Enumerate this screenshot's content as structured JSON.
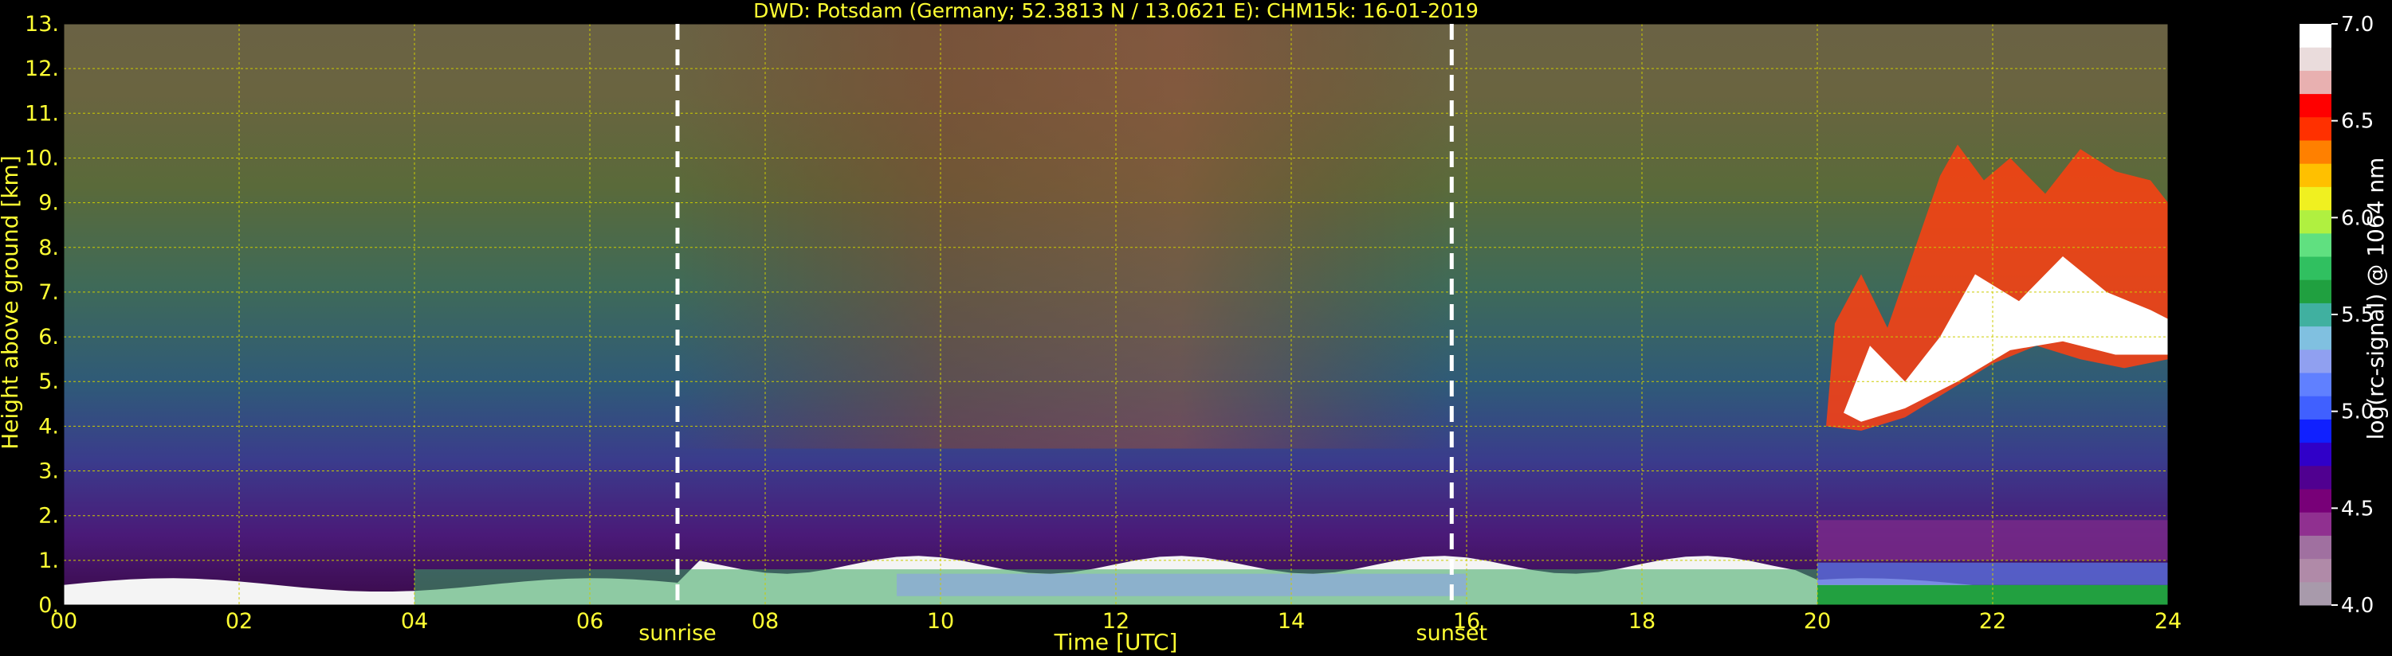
{
  "chart_data": {
    "type": "heatmap",
    "title": "DWD: Potsdam (Germany; 52.3813 N / 13.0621 E):    CHM15k: 16-01-2019",
    "xlabel": "Time [UTC]",
    "ylabel": "Height above ground [km]",
    "xlim": [
      0,
      24
    ],
    "ylim": [
      0,
      13
    ],
    "x_ticks": [
      "00",
      "02",
      "04",
      "06",
      "08",
      "10",
      "12",
      "14",
      "16",
      "18",
      "20",
      "22",
      "24"
    ],
    "y_ticks": [
      "0.",
      "1.",
      "2.",
      "3.",
      "4.",
      "5.",
      "6.",
      "7.",
      "8.",
      "9.",
      "10.",
      "11.",
      "12.",
      "13."
    ],
    "grid": true,
    "events": [
      {
        "label": "sunrise",
        "time": 7.0
      },
      {
        "label": "sunset",
        "time": 15.83
      }
    ],
    "colorbar": {
      "label": "log(rc-signal) @ 1064 nm",
      "range": [
        4.0,
        7.0
      ],
      "ticks": [
        "4.0",
        "4.5",
        "5.0",
        "5.5",
        "6.0",
        "6.5",
        "7.0"
      ],
      "colors": [
        "#a89aab",
        "#b08aa8",
        "#a070a0",
        "#903090",
        "#780078",
        "#500090",
        "#3000c8",
        "#1020ff",
        "#4060ff",
        "#6080ff",
        "#90a0f0",
        "#80c0e0",
        "#40b0a0",
        "#20a040",
        "#30c060",
        "#60e080",
        "#b0f040",
        "#f0f020",
        "#ffc000",
        "#ff8000",
        "#ff3000",
        "#ff0000",
        "#e8b0b0",
        "#eadcdc",
        "#ffffff"
      ]
    }
  }
}
